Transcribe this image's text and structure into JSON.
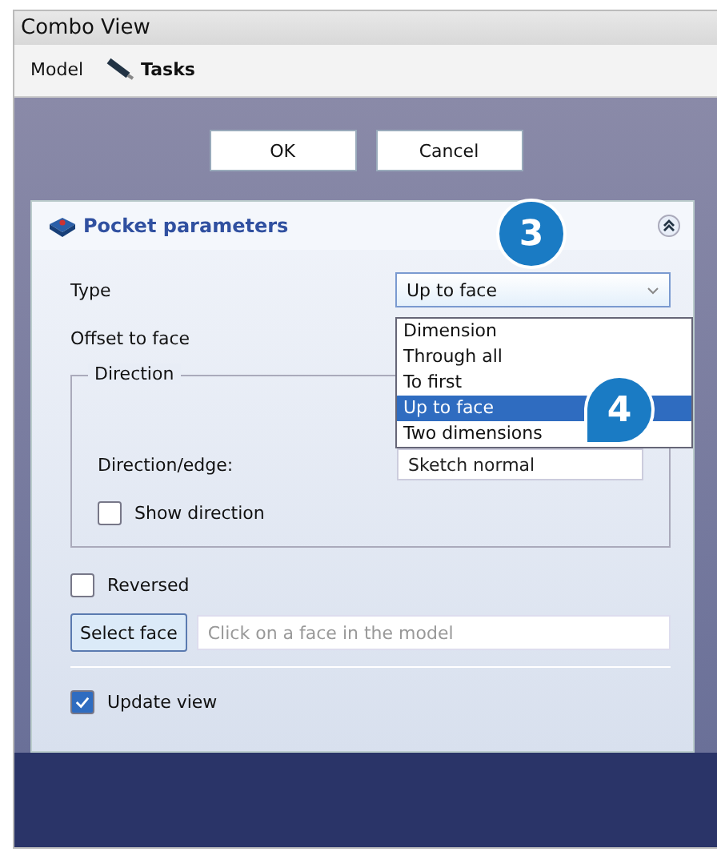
{
  "window": {
    "title": "Combo View"
  },
  "tabs": [
    {
      "label": "Model",
      "selected": false,
      "icon": false
    },
    {
      "label": "Tasks",
      "selected": true,
      "icon": true
    }
  ],
  "buttons": [
    "OK",
    "Cancel"
  ],
  "panel": {
    "title": "Pocket parameters",
    "expanded": true,
    "type": {
      "label": "Type",
      "value": "Up to face",
      "open": true,
      "options": [
        {
          "label": "Dimension",
          "selected": false
        },
        {
          "label": "Through all",
          "selected": false
        },
        {
          "label": "To first",
          "selected": false
        },
        {
          "label": "Up to face",
          "selected": true
        },
        {
          "label": "Two dimensions",
          "selected": false
        }
      ]
    },
    "offset": {
      "label": "Offset to face"
    },
    "direction": {
      "title": "Direction",
      "edge_label": "Direction/edge:",
      "edge_value": "Sketch normal",
      "show": {
        "label": "Show direction",
        "checked": false
      }
    },
    "reversed": {
      "label": "Reversed",
      "checked": false
    },
    "select_face": {
      "button": "Select face",
      "placeholder": "Click on a face in the model"
    },
    "update_view": {
      "label": "Update view",
      "checked": true
    }
  },
  "callouts": [
    "3",
    "4"
  ]
}
